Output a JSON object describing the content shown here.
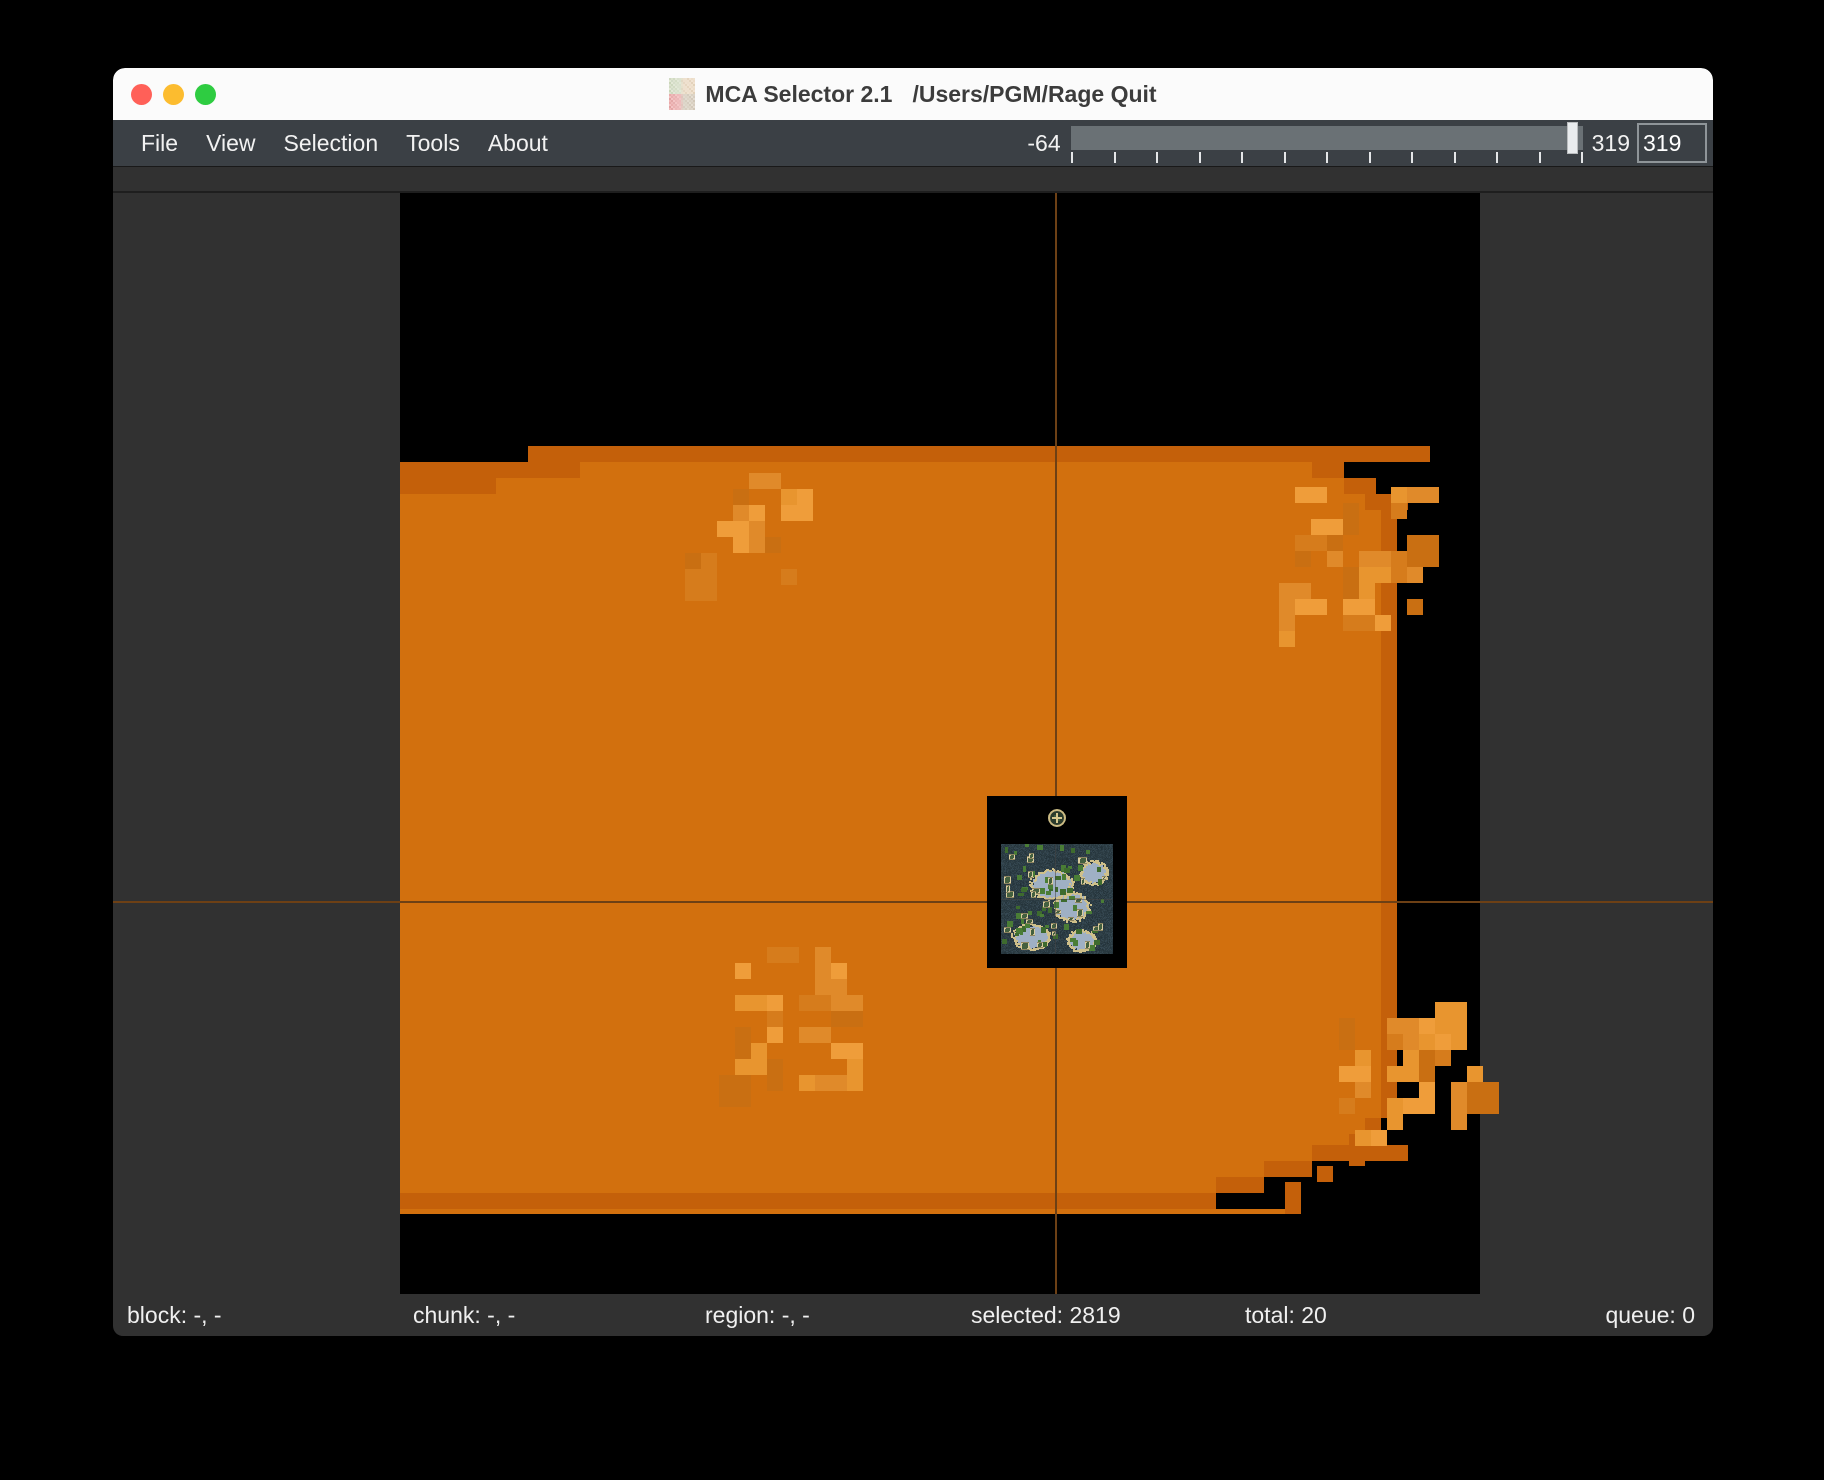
{
  "window": {
    "title_app": "MCA Selector 2.1",
    "title_path": "/Users/PGM/Rage Quit",
    "app_icon": "mca-selector-icon",
    "traffic_lights": {
      "close": "close-button",
      "minimize": "minimize-button",
      "maximize": "maximize-button"
    }
  },
  "menubar": {
    "items": [
      {
        "label": "File"
      },
      {
        "label": "View"
      },
      {
        "label": "Selection"
      },
      {
        "label": "Tools"
      },
      {
        "label": "About"
      }
    ],
    "height_slider": {
      "min_label": "-64",
      "max_label": "319",
      "value": "319",
      "min": -64,
      "max": 319,
      "ticks": 12
    }
  },
  "statusbar": {
    "block": "block: -, -",
    "chunk": "chunk: -, -",
    "region": "region: -, -",
    "selected": "selected: 2819",
    "total": "total: 20",
    "queue": "queue: 0"
  },
  "viewport": {
    "selection_color": "#d2700e",
    "selection_color_dark": "#c4600a",
    "background_color": "#000000",
    "unloaded_color": "#313131",
    "gridline_color": "#6d4015"
  }
}
